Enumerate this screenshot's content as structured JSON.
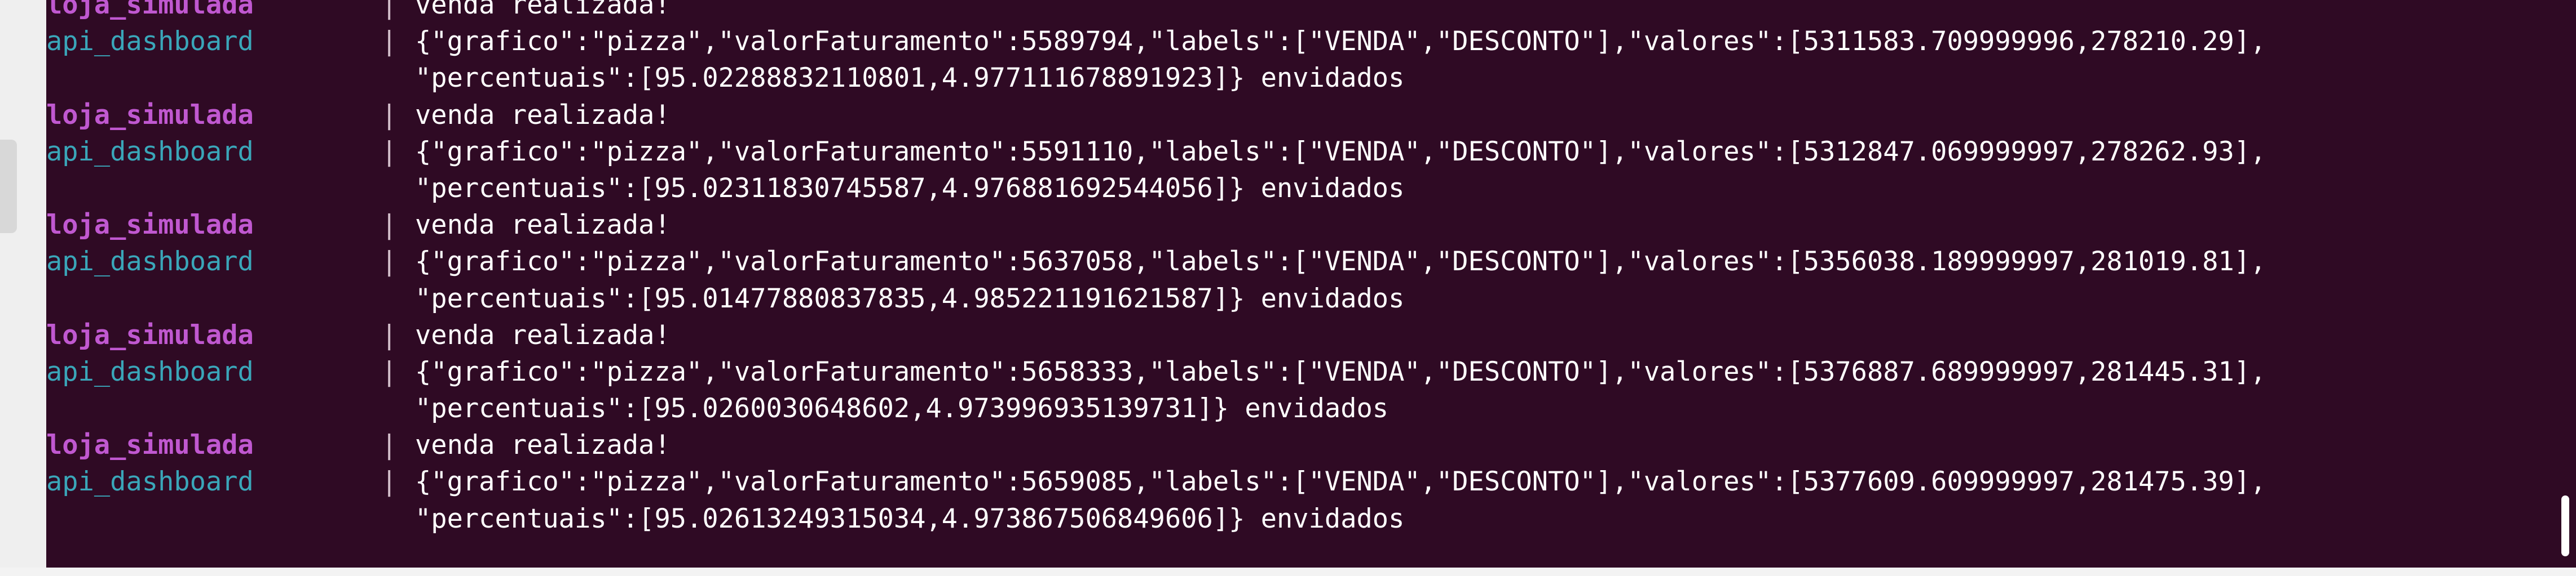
{
  "terminal": {
    "lines": [
      {
        "svc_class": "loja",
        "service": "loja_simulada",
        "sep": "|",
        "text": "venda realizada!"
      },
      {
        "svc_class": "api",
        "service": "api_dashboard",
        "sep": "|",
        "text": "{\"grafico\":\"pizza\",\"valorFaturamento\":5589794,\"labels\":[\"VENDA\",\"DESCONTO\"],\"valores\":[5311583.709999996,278210.29],"
      },
      {
        "svc_class": "cont",
        "service": "",
        "sep": "",
        "text": "\"percentuais\":[95.02288832110801,4.977111678891923]} envidados"
      },
      {
        "svc_class": "loja",
        "service": "loja_simulada",
        "sep": "|",
        "text": "venda realizada!"
      },
      {
        "svc_class": "api",
        "service": "api_dashboard",
        "sep": "|",
        "text": "{\"grafico\":\"pizza\",\"valorFaturamento\":5591110,\"labels\":[\"VENDA\",\"DESCONTO\"],\"valores\":[5312847.069999997,278262.93],"
      },
      {
        "svc_class": "cont",
        "service": "",
        "sep": "",
        "text": "\"percentuais\":[95.02311830745587,4.976881692544056]} envidados"
      },
      {
        "svc_class": "loja",
        "service": "loja_simulada",
        "sep": "|",
        "text": "venda realizada!"
      },
      {
        "svc_class": "api",
        "service": "api_dashboard",
        "sep": "|",
        "text": "{\"grafico\":\"pizza\",\"valorFaturamento\":5637058,\"labels\":[\"VENDA\",\"DESCONTO\"],\"valores\":[5356038.189999997,281019.81],"
      },
      {
        "svc_class": "cont",
        "service": "",
        "sep": "",
        "text": "\"percentuais\":[95.01477880837835,4.985221191621587]} envidados"
      },
      {
        "svc_class": "loja",
        "service": "loja_simulada",
        "sep": "|",
        "text": "venda realizada!"
      },
      {
        "svc_class": "api",
        "service": "api_dashboard",
        "sep": "|",
        "text": "{\"grafico\":\"pizza\",\"valorFaturamento\":5658333,\"labels\":[\"VENDA\",\"DESCONTO\"],\"valores\":[5376887.689999997,281445.31],"
      },
      {
        "svc_class": "cont",
        "service": "",
        "sep": "",
        "text": "\"percentuais\":[95.0260030648602,4.973996935139731]} envidados"
      },
      {
        "svc_class": "loja",
        "service": "loja_simulada",
        "sep": "|",
        "text": "venda realizada!"
      },
      {
        "svc_class": "api",
        "service": "api_dashboard",
        "sep": "|",
        "text": "{\"grafico\":\"pizza\",\"valorFaturamento\":5659085,\"labels\":[\"VENDA\",\"DESCONTO\"],\"valores\":[5377609.609999997,281475.39],"
      },
      {
        "svc_class": "cont",
        "service": "",
        "sep": "",
        "text": "\"percentuais\":[95.02613249315034,4.973867506849606]} envidados"
      }
    ]
  },
  "colors": {
    "background": "#2f0a24",
    "loja_simulada": "#c058d0",
    "api_dashboard": "#3aa6b9",
    "text": "#ffffff"
  }
}
